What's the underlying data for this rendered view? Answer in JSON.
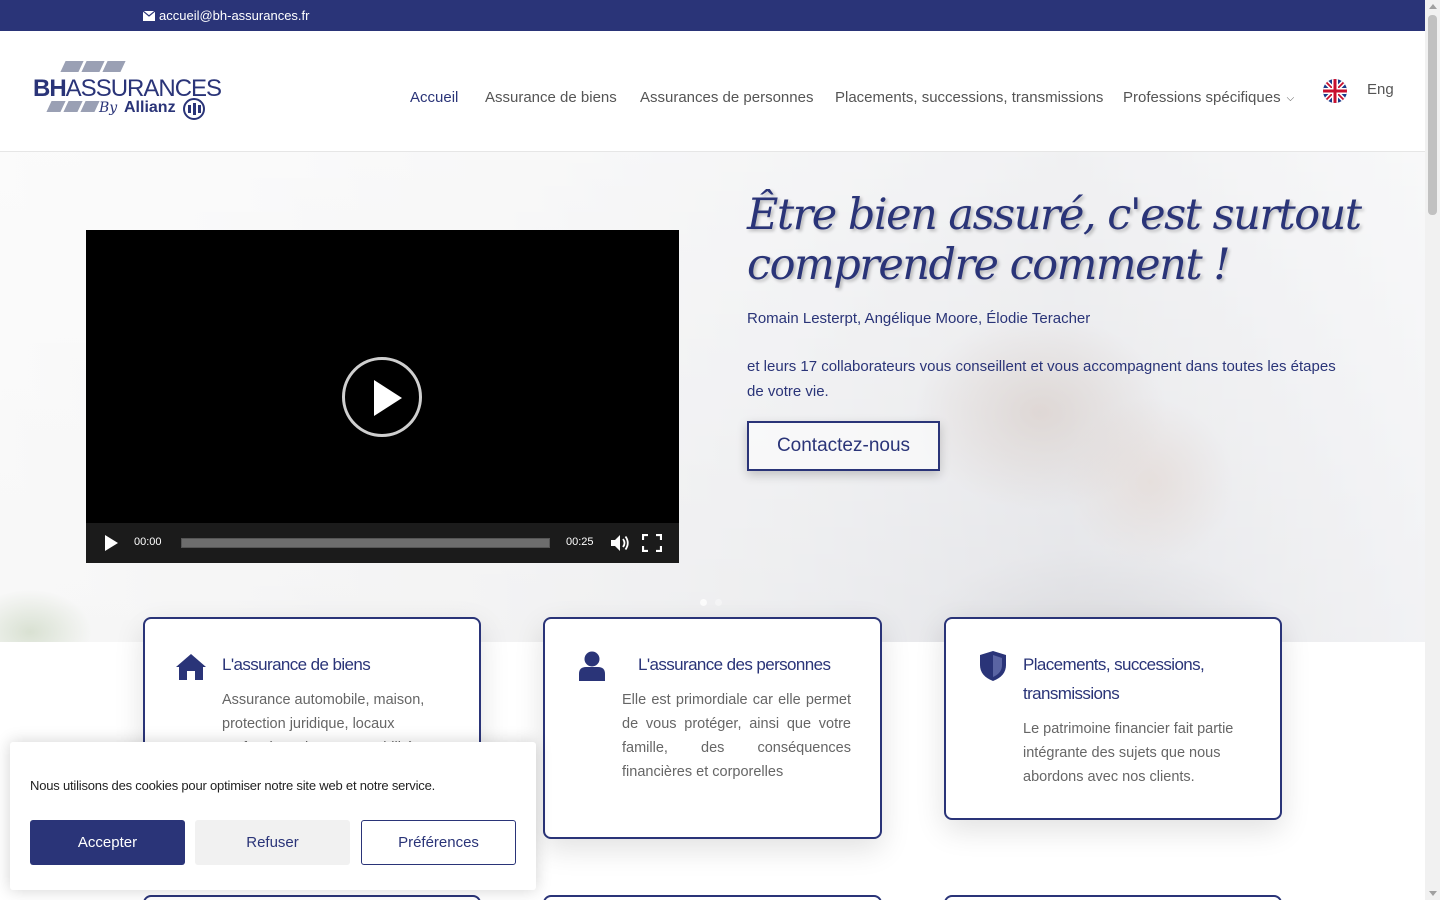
{
  "topbar": {
    "email": "accueil@bh-assurances.fr"
  },
  "logo": {
    "bh": "BH",
    "assurances": "ASSURANCES",
    "by": "By",
    "allianz": "Allianz"
  },
  "nav": {
    "items": [
      {
        "label": "Accueil",
        "active": true
      },
      {
        "label": "Assurance de biens"
      },
      {
        "label": "Assurances de personnes"
      },
      {
        "label": "Placements, successions, transmissions"
      },
      {
        "label": "Professions spécifiques"
      }
    ],
    "lang": "Eng"
  },
  "hero": {
    "slogan": "Être bien assuré, c'est surtout comprendre comment !",
    "names": "Romain Lesterpt, Angélique Moore, Élodie Teracher",
    "description": "et leurs 17 collaborateurs vous conseillent et vous accompagnent dans toutes les étapes de votre vie.",
    "cta": "Contactez-nous",
    "video": {
      "current": "00:00",
      "duration": "00:25",
      "progress": 0
    }
  },
  "cards": [
    {
      "title": "L'assurance de biens",
      "text": "Assurance automobile, maison, protection juridique, locaux professionnels, responsabilité"
    },
    {
      "title": "L'assurance des personnes",
      "text": "Elle est primordiale car elle permet de vous protéger, ainsi que votre famille, des conséquences financières et corporelles"
    },
    {
      "title": "Placements, successions, transmissions",
      "text": "Le patrimoine financier fait partie intégrante des sujets que nous abordons avec nos clients."
    }
  ],
  "cookie": {
    "message": "Nous utilisons des cookies pour optimiser notre site web et notre service.",
    "accept": "Accepter",
    "refuse": "Refuser",
    "preferences": "Préférences"
  },
  "colors": {
    "brand": "#2a3478",
    "text": "#555555"
  }
}
